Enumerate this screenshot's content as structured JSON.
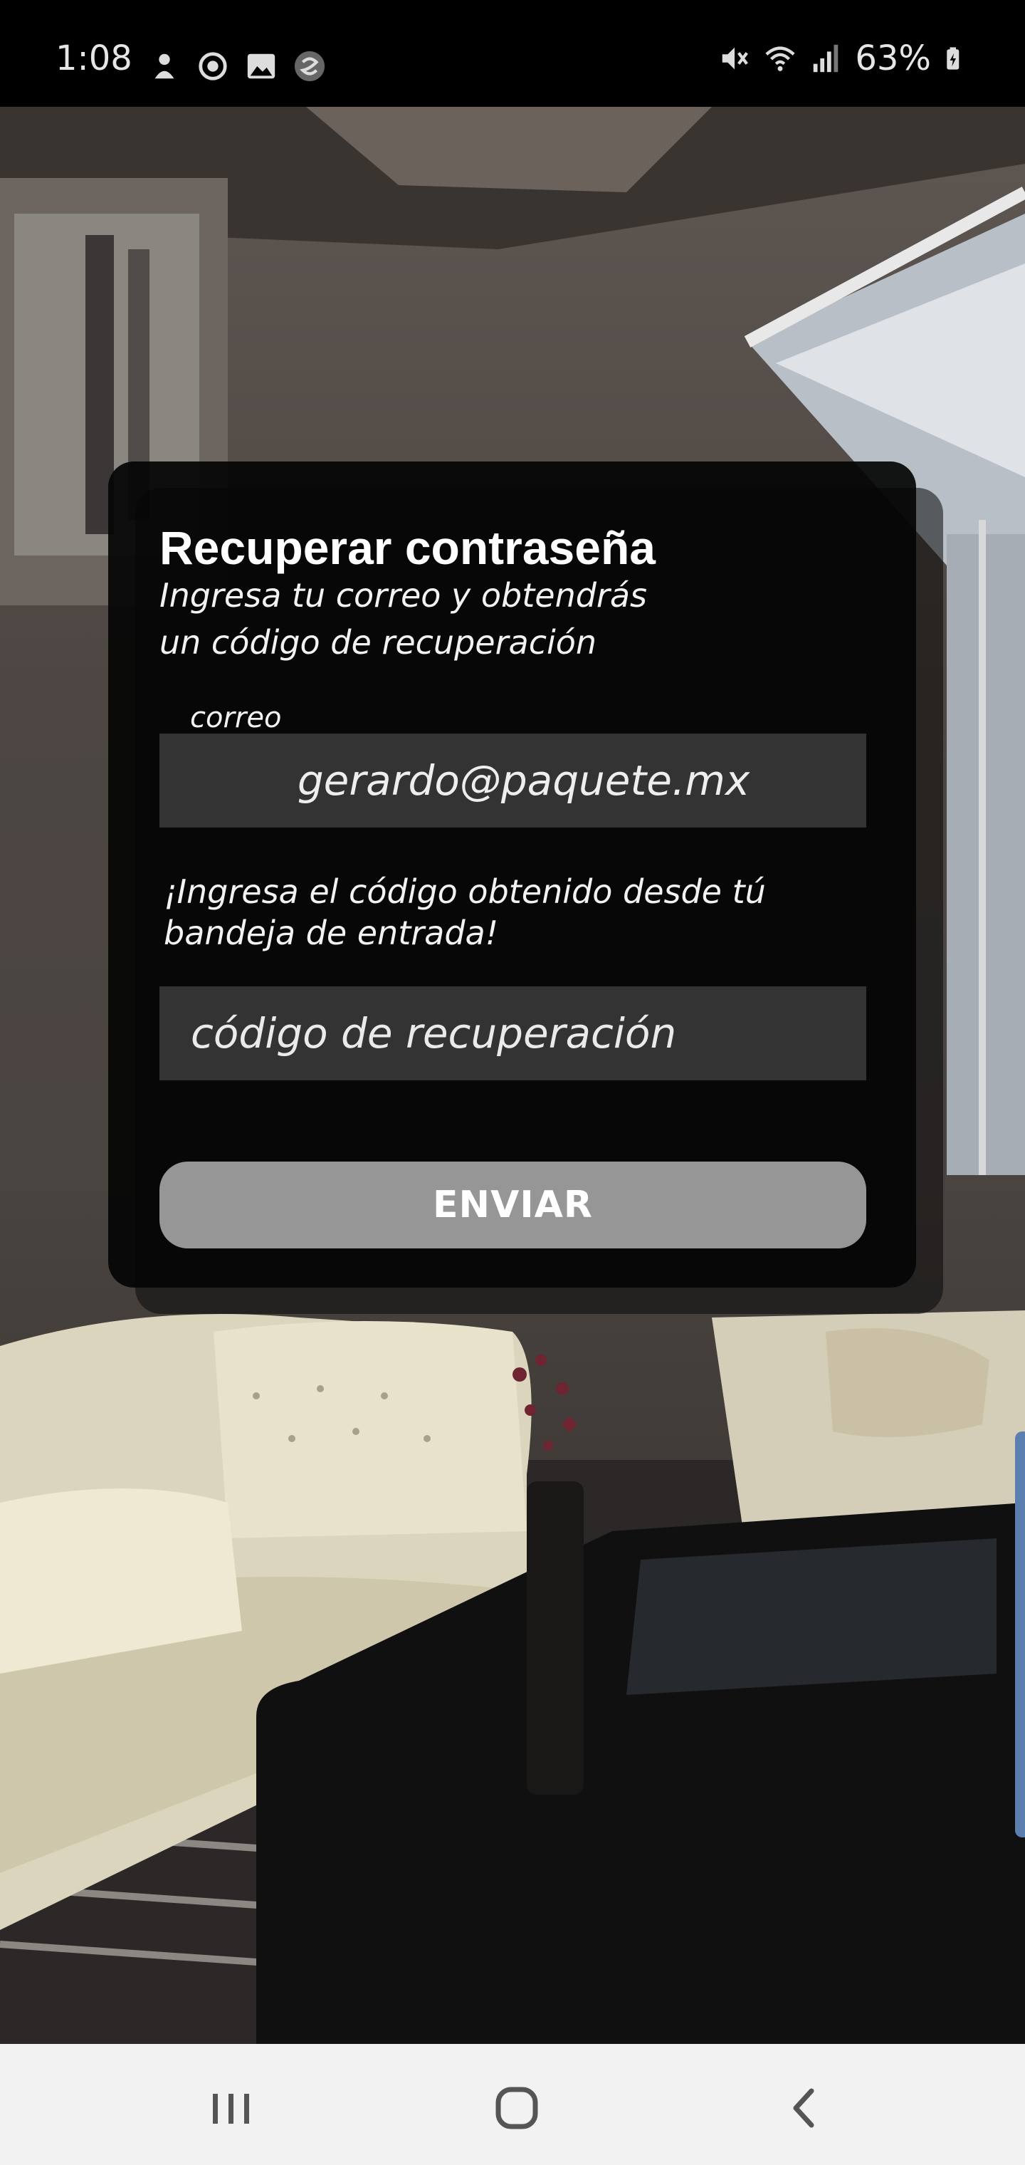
{
  "status_bar": {
    "time": "1:08",
    "battery": "63%",
    "left_icons": [
      "notification-icon",
      "sync-icon",
      "image-icon",
      "app-icon"
    ],
    "right_icons": [
      "mute-icon",
      "wifi-icon",
      "signal-icon",
      "battery-icon"
    ]
  },
  "dialog": {
    "title": "Recuperar contraseña",
    "subtitle": "Ingresa tu correo y obtendrás un código de recuperación",
    "email_label": "correo",
    "email_value": "gerardo@paquete.mx",
    "code_instructions": "¡Ingresa el código obtenido desde tú bandeja de entrada!",
    "code_placeholder": "código de recuperación",
    "submit_label": "ENVIAR"
  },
  "nav_bar": {
    "buttons": [
      "recent-apps-icon",
      "home-icon",
      "back-icon"
    ]
  },
  "colors": {
    "dialog_bg": "#050505",
    "input_bg": "#333333",
    "button_bg": "#969696",
    "nav_bg": "#f2f2f2"
  }
}
